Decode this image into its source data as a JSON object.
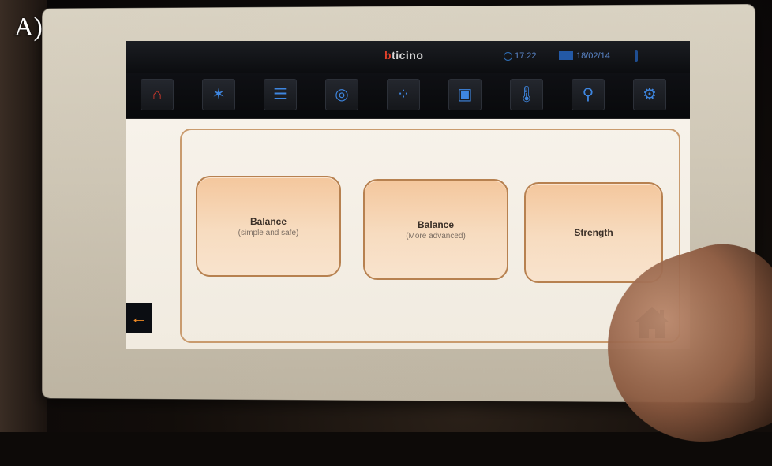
{
  "label": "A)",
  "header": {
    "brand_prefix": "b",
    "brand_rest": "ticino",
    "time": "17:22",
    "date": "18/02/14"
  },
  "toolbar": {
    "items": [
      {
        "icon": "home-icon",
        "glyph": "⌂"
      },
      {
        "icon": "light-bulb-icon",
        "glyph": "✶"
      },
      {
        "icon": "shutters-icon",
        "glyph": "☰"
      },
      {
        "icon": "audio-icon",
        "glyph": "◎"
      },
      {
        "icon": "scenario-icon",
        "glyph": "⁘"
      },
      {
        "icon": "intercom-icon",
        "glyph": "▣"
      },
      {
        "icon": "thermometer-icon",
        "glyph": "🌡"
      },
      {
        "icon": "irrigation-icon",
        "glyph": "⚲"
      },
      {
        "icon": "settings-icon",
        "glyph": "⚙"
      }
    ]
  },
  "cards": [
    {
      "title": "Balance",
      "subtitle": "(simple and safe)"
    },
    {
      "title": "Balance",
      "subtitle": "(More advanced)"
    },
    {
      "title": "Strength",
      "subtitle": ""
    }
  ],
  "nav": {
    "back_glyph": "←"
  },
  "colors": {
    "accent_blue": "#3e86e0",
    "home_red": "#e33b2c",
    "card_border": "#b78150",
    "back_orange": "#f08a25"
  }
}
